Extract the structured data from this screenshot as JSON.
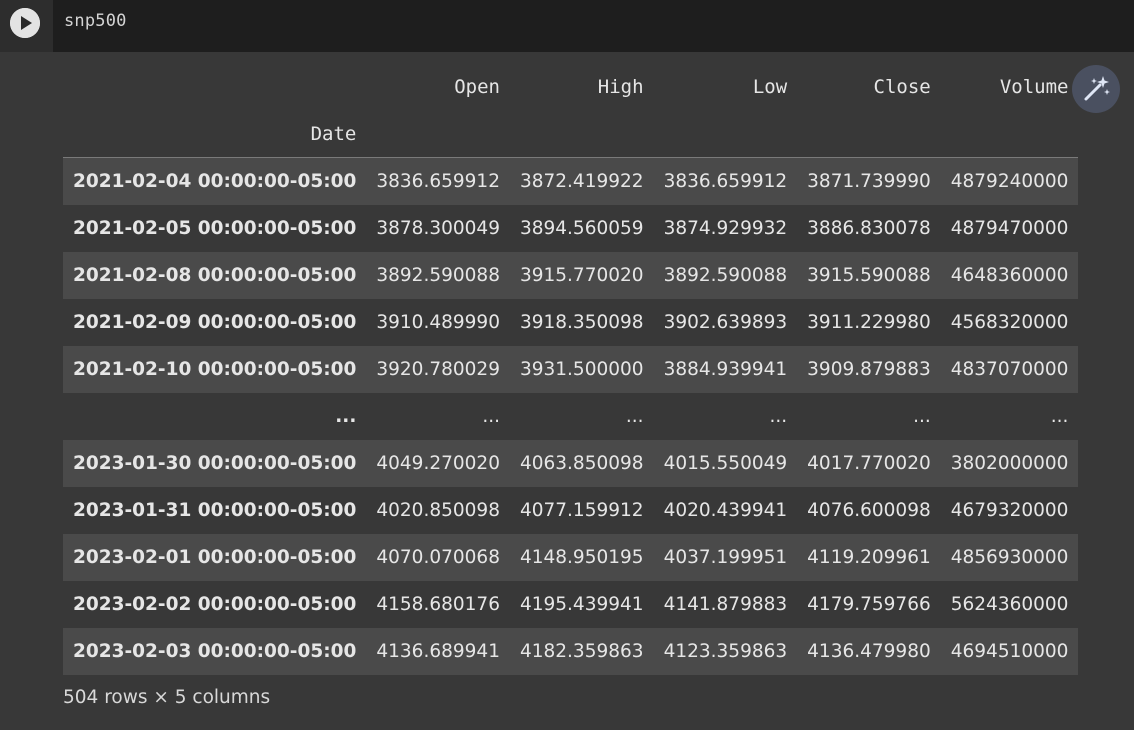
{
  "cell": {
    "code": "snp500",
    "run_icon": "play-icon"
  },
  "toolbar": {
    "magic_icon": "magic-wand-sparkle-icon"
  },
  "table": {
    "columns": [
      "Open",
      "High",
      "Low",
      "Close",
      "Volume"
    ],
    "index_name": "Date",
    "rows": [
      {
        "date": "2021-02-04 00:00:00-05:00",
        "values": [
          "3836.659912",
          "3872.419922",
          "3836.659912",
          "3871.739990",
          "4879240000"
        ]
      },
      {
        "date": "2021-02-05 00:00:00-05:00",
        "values": [
          "3878.300049",
          "3894.560059",
          "3874.929932",
          "3886.830078",
          "4879470000"
        ]
      },
      {
        "date": "2021-02-08 00:00:00-05:00",
        "values": [
          "3892.590088",
          "3915.770020",
          "3892.590088",
          "3915.590088",
          "4648360000"
        ]
      },
      {
        "date": "2021-02-09 00:00:00-05:00",
        "values": [
          "3910.489990",
          "3918.350098",
          "3902.639893",
          "3911.229980",
          "4568320000"
        ]
      },
      {
        "date": "2021-02-10 00:00:00-05:00",
        "values": [
          "3920.780029",
          "3931.500000",
          "3884.939941",
          "3909.879883",
          "4837070000"
        ]
      },
      {
        "date": "...",
        "values": [
          "...",
          "...",
          "...",
          "...",
          "..."
        ]
      },
      {
        "date": "2023-01-30 00:00:00-05:00",
        "values": [
          "4049.270020",
          "4063.850098",
          "4015.550049",
          "4017.770020",
          "3802000000"
        ]
      },
      {
        "date": "2023-01-31 00:00:00-05:00",
        "values": [
          "4020.850098",
          "4077.159912",
          "4020.439941",
          "4076.600098",
          "4679320000"
        ]
      },
      {
        "date": "2023-02-01 00:00:00-05:00",
        "values": [
          "4070.070068",
          "4148.950195",
          "4037.199951",
          "4119.209961",
          "4856930000"
        ]
      },
      {
        "date": "2023-02-02 00:00:00-05:00",
        "values": [
          "4158.680176",
          "4195.439941",
          "4141.879883",
          "4179.759766",
          "5624360000"
        ]
      },
      {
        "date": "2023-02-03 00:00:00-05:00",
        "values": [
          "4136.689941",
          "4182.359863",
          "4123.359863",
          "4136.479980",
          "4694510000"
        ]
      }
    ],
    "shape_note": "504 rows × 5 columns"
  },
  "colors": {
    "background": "#383838",
    "cell_background": "#1e1e1e",
    "row_stripe": "#4a4a4a",
    "text": "#e6e6e6"
  }
}
